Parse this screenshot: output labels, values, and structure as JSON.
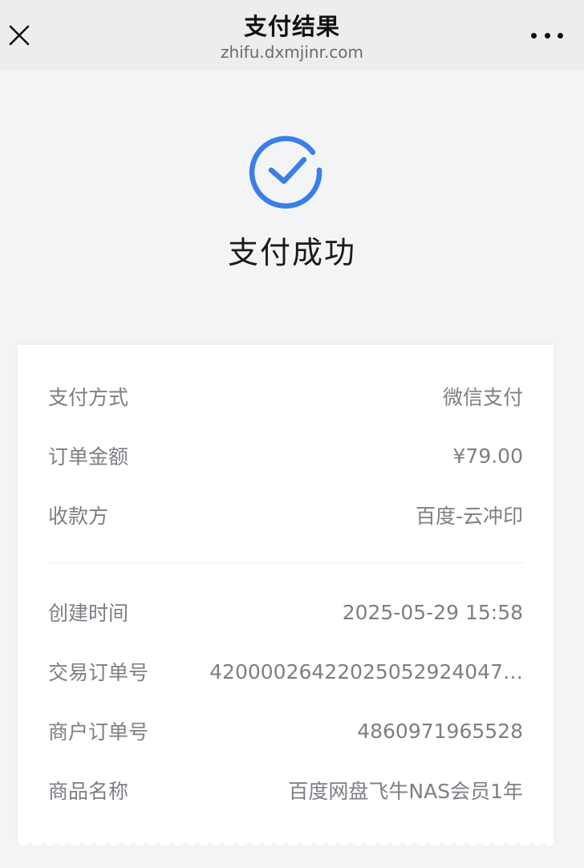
{
  "nav": {
    "title": "支付结果",
    "url": "zhifu.dxmjinr.com"
  },
  "status": {
    "text": "支付成功",
    "accent_color": "#3a7ee8"
  },
  "details": [
    {
      "label": "支付方式",
      "value": "微信支付"
    },
    {
      "label": "订单金额",
      "value": "¥79.00"
    },
    {
      "label": "收款方",
      "value": "百度-云冲印"
    },
    {
      "label": "创建时间",
      "value": "2025-05-29 15:58"
    },
    {
      "label": "交易订单号",
      "value": "42000026422025052924047…"
    },
    {
      "label": "商户订单号",
      "value": "4860971965528"
    },
    {
      "label": "商品名称",
      "value": "百度网盘飞牛NAS会员1年"
    }
  ],
  "icons": {
    "close": "close-icon",
    "more": "more-icon",
    "success": "check-circle-icon"
  }
}
